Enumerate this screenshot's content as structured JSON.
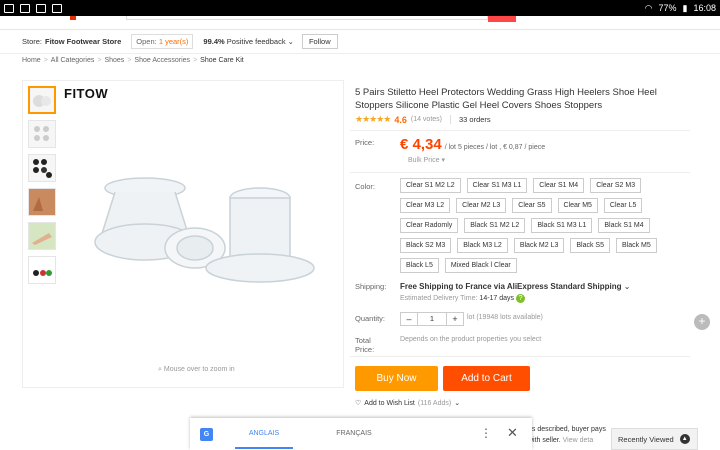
{
  "statusbar": {
    "battery": "77%",
    "time": "16:08"
  },
  "store": {
    "label": "Store:",
    "name": "Fitow Footwear Store",
    "open_label": "Open:",
    "open_years": "1 year(s)",
    "feedback_pct": "99.4%",
    "feedback_label": "Positive feedback",
    "follow": "Follow"
  },
  "breadcrumb": [
    "Home",
    "All Categories",
    "Shoes",
    "Shoe Accessories",
    "Shoe Care Kit"
  ],
  "gallery": {
    "brand": "FITOW",
    "zoom_hint": "Mouse over to zoom in"
  },
  "product": {
    "title": "5 Pairs Stiletto Heel Protectors Wedding Grass High Heelers Shoe Heel Stoppers Silicone Plastic Gel Heel Covers Shoes Stoppers",
    "stars": "★★★★★",
    "rating": "4.6",
    "votes": "(14 votes)",
    "orders": "33 orders",
    "price_label": "Price:",
    "price": "€ 4,34",
    "price_detail": "/ lot 5 pieces / lot , € 0,87 / piece",
    "bulk": "Bulk Price",
    "color_label": "Color:",
    "colors": [
      "Clear S1 M2 L2",
      "Clear S1 M3 L1",
      "Clear S1 M4",
      "Clear S2 M3",
      "Clear M3 L2",
      "Clear M2 L3",
      "Clear S5",
      "Clear M5",
      "Clear L5",
      "Clear Radomly",
      "Black S1 M2 L2",
      "Black S1 M3 L1",
      "Black S1 M4",
      "Black S2 M3",
      "Black M3 L2",
      "Black M2 L3",
      "Black S5",
      "Black M5",
      "Black L5",
      "Mixed Black l Clear"
    ],
    "shipping_label": "Shipping:",
    "shipping_free": "Free Shipping to France via AliExpress Standard Shipping",
    "est_label": "Estimated Delivery Time:",
    "est_days": "14-17 days",
    "quantity_label": "Quantity:",
    "qty_minus": "–",
    "qty_value": "1",
    "qty_plus": "+",
    "qty_note": "lot (19948 lots available)",
    "total_label": "Total Price:",
    "total_note": "Depends on the product properties you select",
    "buy_now": "Buy Now",
    "add_to_cart": "Add to Cart",
    "wishlist": "Add to Wish List",
    "wishlist_count": "(116 Adds)"
  },
  "protection": {
    "line1": "as described, buyer pays",
    "line2": "with seller.",
    "link": "View deta"
  },
  "translate": {
    "tab_source": "ANGLAIS",
    "tab_target": "FRANÇAIS",
    "more": "⋮",
    "close": "✕"
  },
  "recently_viewed": "Recently Viewed",
  "colors": {
    "accent": "#ff6a00",
    "buy": "#ff9900",
    "cart": "#ff4e00",
    "price": "#ff4400"
  }
}
